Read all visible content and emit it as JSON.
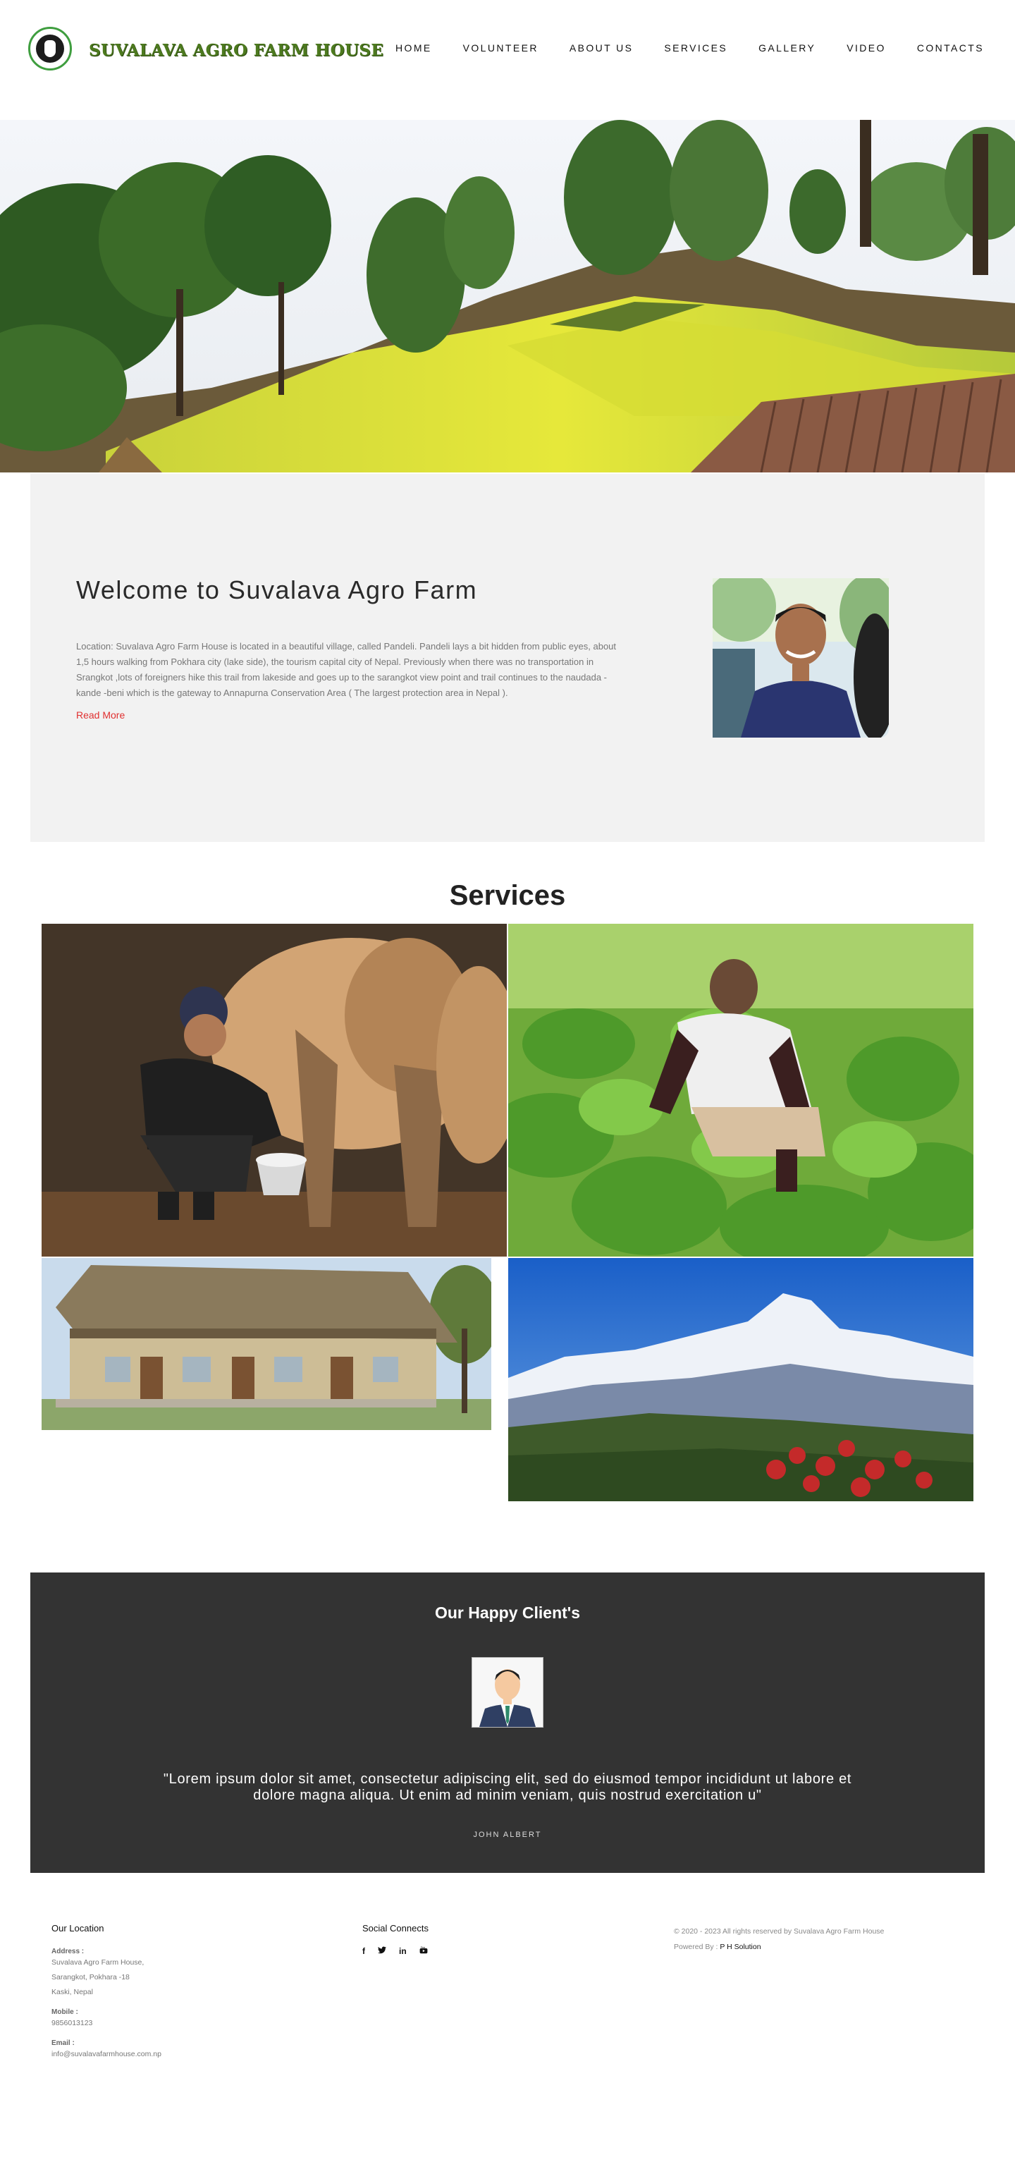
{
  "header": {
    "brand": "SUVALAVA AGRO FARM HOUSE",
    "nav": [
      "HOME",
      "VOLUNTEER",
      "ABOUT US",
      "SERVICES",
      "GALLERY",
      "VIDEO",
      "CONTACTS"
    ]
  },
  "welcome": {
    "title": "Welcome to Suvalava Agro Farm",
    "text": "Location: Suvalava Agro Farm House is located in a beautiful village, called Pandeli. Pandeli lays a bit hidden from public eyes, about 1,5 hours walking from Pokhara city (lake side), the tourism capital city of Nepal. Previously when there was no transportation in Srangkot ,lots of foreigners hike this trail from lakeside and goes up to the sarangkot view point and trail continues to the naudada - kande -beni which is the gateway to Annapurna Conservation Area ( The largest protection area in Nepal ).",
    "read_more": "Read More"
  },
  "services": {
    "title": "Services"
  },
  "clients": {
    "title": "Our Happy Client's",
    "quote": "\"Lorem ipsum dolor sit amet, consectetur adipiscing elit, sed do eiusmod tempor incididunt ut labore et dolore magna aliqua. Ut enim ad minim veniam, quis nostrud exercitation u\"",
    "name": "JOHN ALBERT"
  },
  "footer": {
    "location": {
      "heading": "Our Location",
      "address_label": "Address :",
      "address_lines": [
        "Suvalava Agro Farm House,",
        "Sarangkot, Pokhara -18",
        "Kaski, Nepal"
      ],
      "mobile_label": "Mobile :",
      "mobile": "9856013123",
      "email_label": "Email :",
      "email": "info@suvalavafarmhouse.com.np"
    },
    "social": {
      "heading": "Social Connects",
      "icons": [
        "f",
        "t",
        "in",
        "yt"
      ]
    },
    "copyright": "© 2020 - 2023 All rights reserved by Suvalava Agro Farm House",
    "powered_label": "Powered By :",
    "powered_by": "P H Solution"
  }
}
